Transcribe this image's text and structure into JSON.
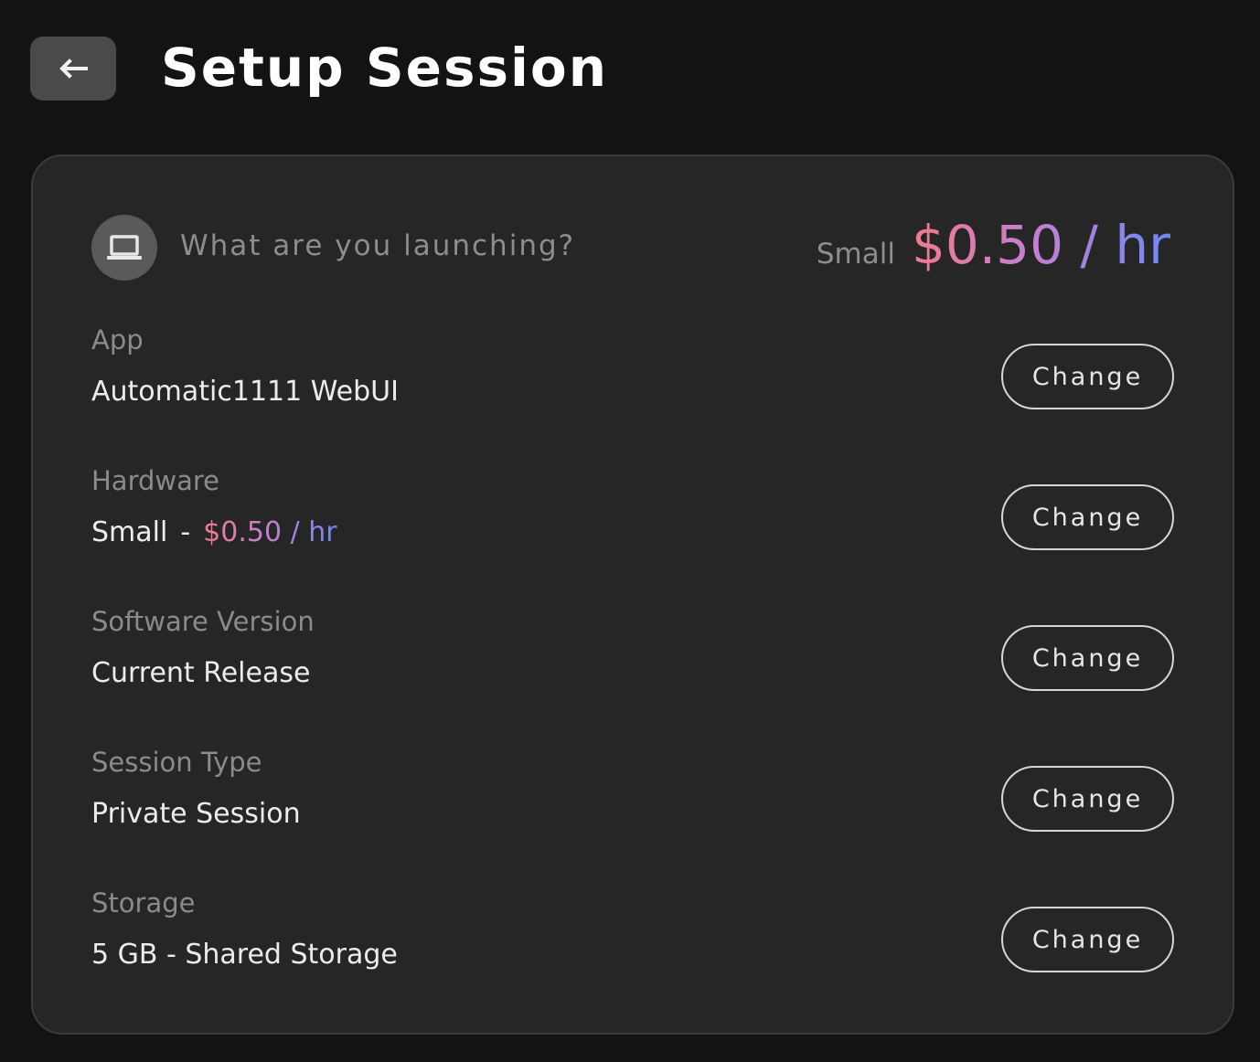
{
  "header": {
    "back_icon": "arrow-left-icon",
    "title": "Setup Session"
  },
  "card": {
    "icon": "laptop-icon",
    "question": "What are you launching?",
    "size": "Small",
    "price": "$0.50 / hr"
  },
  "rows": [
    {
      "label": "App",
      "value": "Automatic1111 WebUI",
      "button": "Change"
    },
    {
      "label": "Hardware",
      "size": "Small",
      "separator": "-",
      "price": "$0.50 / hr",
      "button": "Change"
    },
    {
      "label": "Software Version",
      "value": "Current Release",
      "button": "Change"
    },
    {
      "label": "Session Type",
      "value": "Private Session",
      "button": "Change"
    },
    {
      "label": "Storage",
      "value": "5 GB - Shared Storage",
      "button": "Change"
    }
  ],
  "colors": {
    "background": "#131313",
    "card": "#262626",
    "price_gradient": [
      "#f2798f",
      "#c17fd4",
      "#6e88f5"
    ]
  }
}
